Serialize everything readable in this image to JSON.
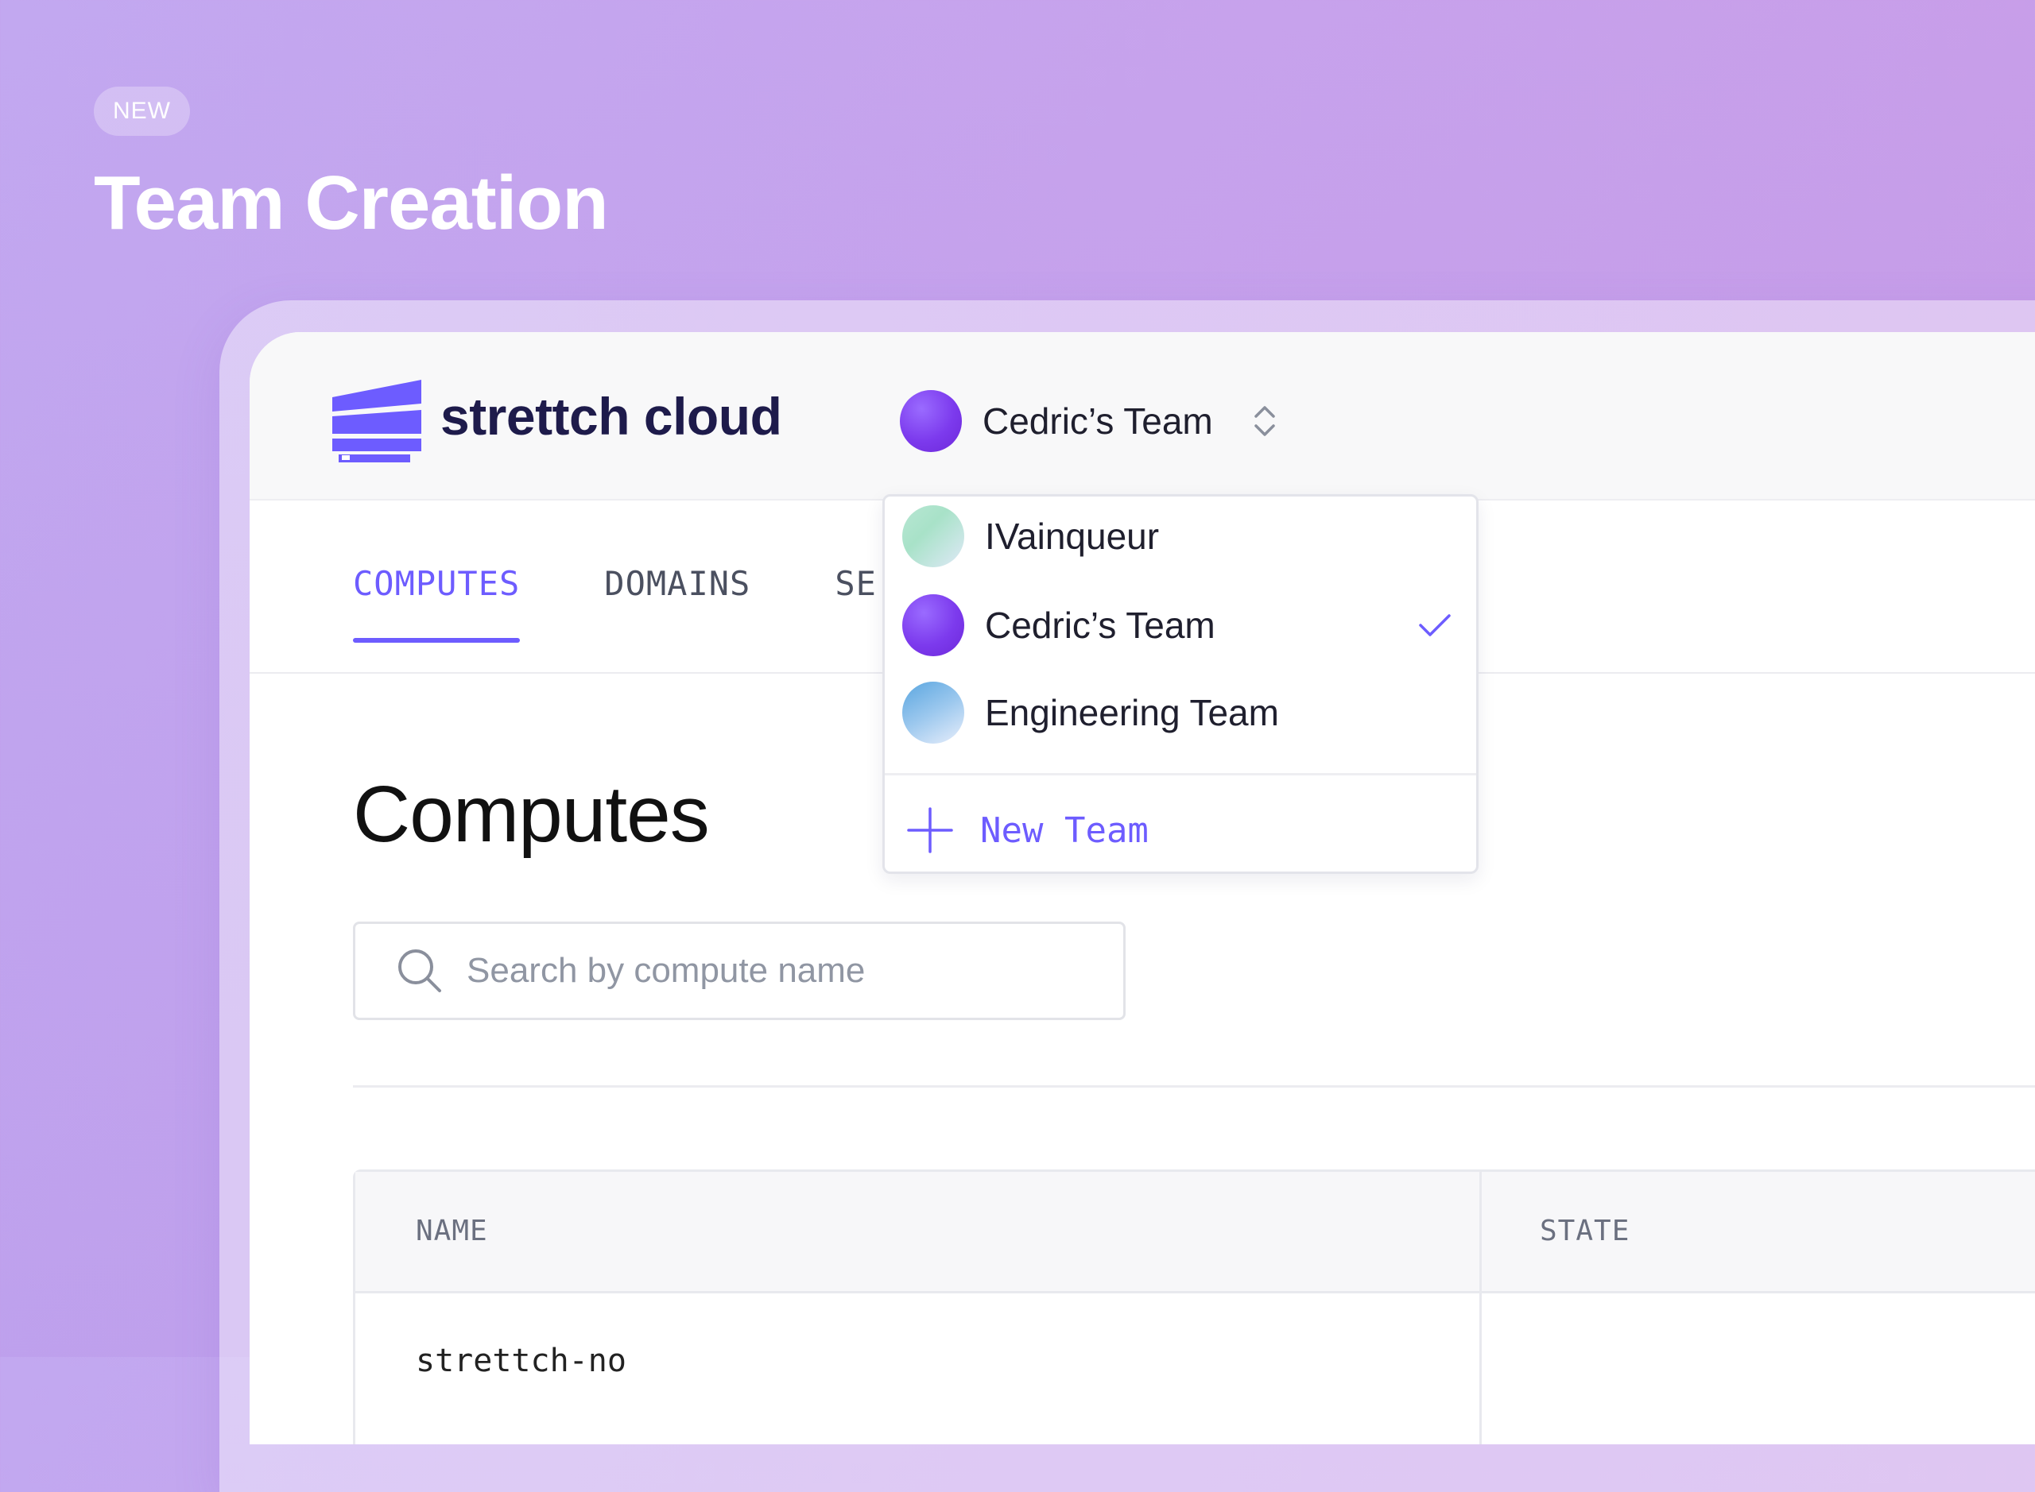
{
  "hero": {
    "badge": "NEW",
    "title": "Team Creation"
  },
  "header": {
    "brand": "strettch cloud",
    "current_team": "Cedric’s Team"
  },
  "tabs": [
    {
      "label": "COMPUTES",
      "active": true
    },
    {
      "label": "DOMAINS",
      "active": false
    },
    {
      "label": "SE",
      "active": false
    }
  ],
  "page": {
    "title": "Computes",
    "search_placeholder": "Search by compute name"
  },
  "table": {
    "columns": [
      "NAME",
      "STATE"
    ],
    "rows": [
      {
        "name": "strettch-no"
      }
    ]
  },
  "team_menu": {
    "items": [
      {
        "name": "IVainqueur",
        "avatar": "mint-gradient",
        "selected": false
      },
      {
        "name": "Cedric’s Team",
        "avatar": "violet",
        "selected": true
      },
      {
        "name": "Engineering Team",
        "avatar": "blue-gradient",
        "selected": false
      }
    ],
    "new_team_label": "New Team"
  },
  "colors": {
    "accent": "#6d5cff",
    "brand_text": "#1e1b4b",
    "brand_logo": "#6d5cff",
    "background_gradient": [
      "#c2a8f0",
      "#c89ae6"
    ]
  },
  "icons": {
    "logo": "strettch-logo-icon",
    "chevrons": "chevron-up-down-icon",
    "check": "check-icon",
    "plus": "plus-icon",
    "search": "search-icon"
  }
}
